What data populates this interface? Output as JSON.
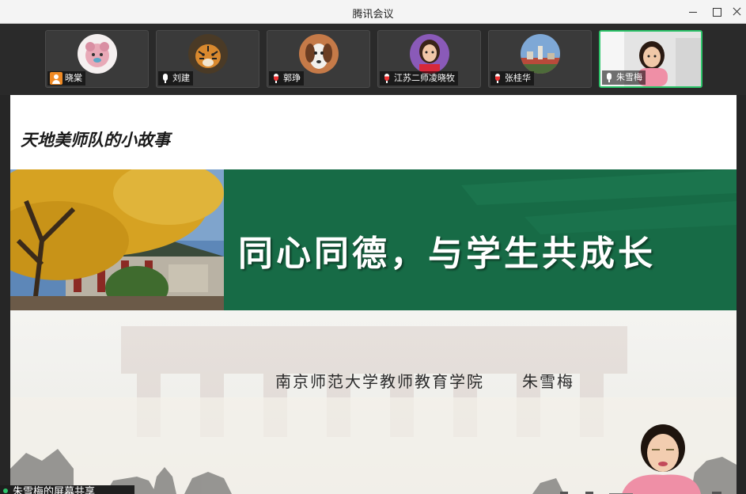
{
  "window": {
    "title": "腾讯会议",
    "controls": [
      "minimize-icon",
      "maximize-icon",
      "close-icon"
    ]
  },
  "participants": [
    {
      "name": "晓棠",
      "icon": "user-icon",
      "avatar": "pink-plush-avatar"
    },
    {
      "name": "刘建",
      "icon": "mic-icon",
      "avatar": "tiger-avatar"
    },
    {
      "name": "郭琤",
      "icon": "mic-icon",
      "avatar": "dog-avatar"
    },
    {
      "name": "江苏二师凌晓牧",
      "icon": "mic-icon",
      "avatar": "woman-avatar"
    },
    {
      "name": "张桂华",
      "icon": "mic-icon",
      "avatar": "city-avatar"
    },
    {
      "name": "朱雪梅",
      "icon": "mic-icon",
      "avatar": "live-video",
      "active": true
    }
  ],
  "slide": {
    "section_title": "天地美师队的小故事",
    "banner_title": "同心同德，与学生共成长",
    "institution": "南京师范大学教师教育学院",
    "presenter": "朱雪梅"
  },
  "share_bar": {
    "label": "朱雪梅的屏幕共享"
  },
  "colors": {
    "banner_green": "#176b46",
    "active_border": "#2ec56b",
    "titlebar": "#f4f4f4",
    "strip_bg": "#2a2a2a"
  }
}
